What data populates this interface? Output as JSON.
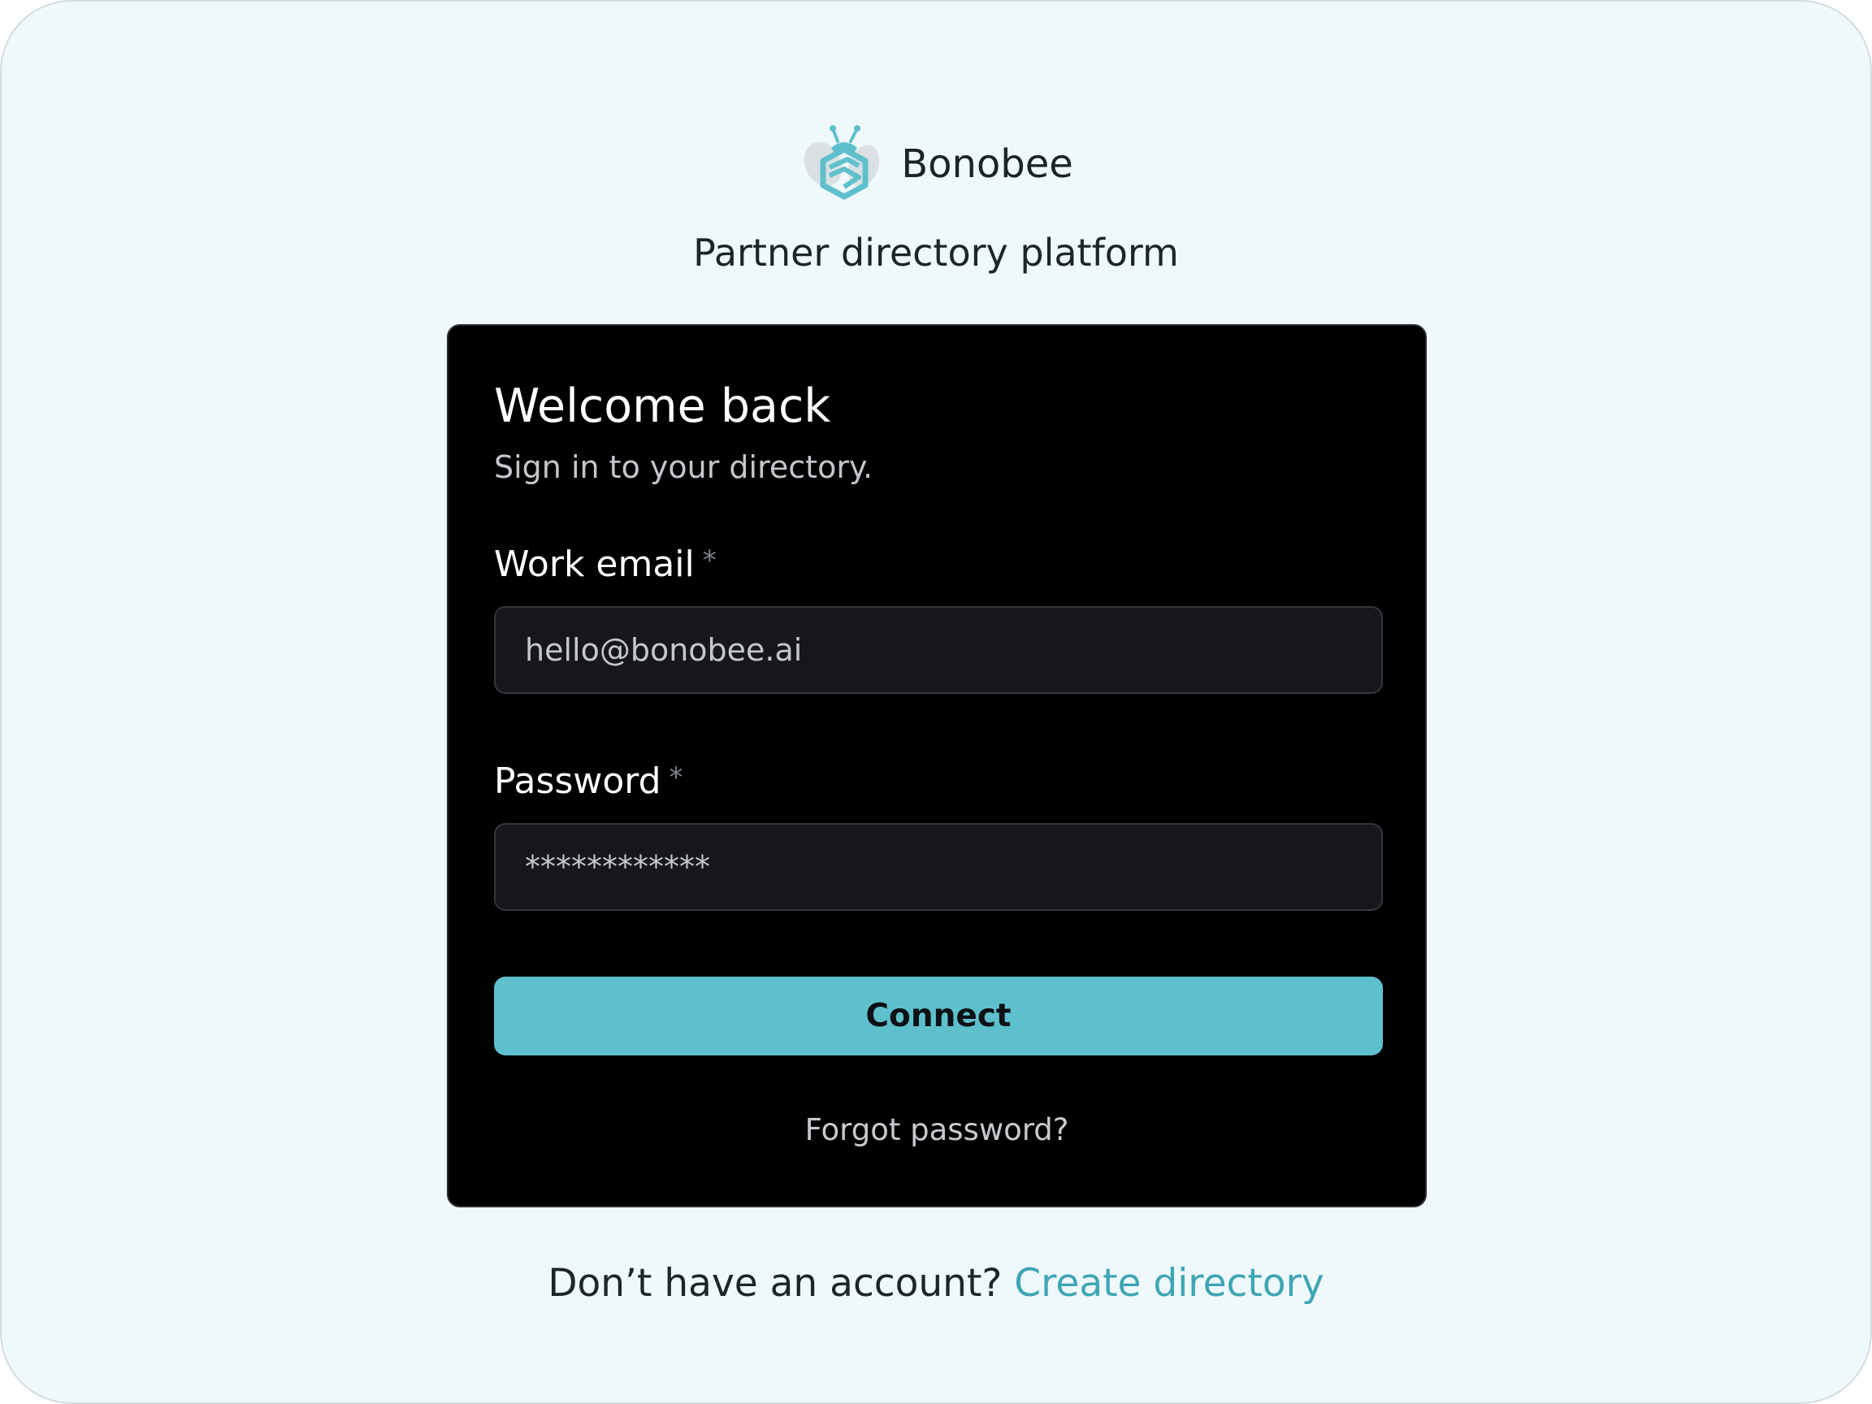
{
  "brand": {
    "name": "Bonobee",
    "logo_icon": "bee-logo-icon",
    "tagline": "Partner directory platform"
  },
  "login_card": {
    "title": "Welcome back",
    "subtitle": "Sign in to your directory.",
    "email_label": "Work email",
    "email_required_marker": "*",
    "email_value": "hello@bonobee.ai",
    "password_label": "Password",
    "password_required_marker": "*",
    "password_value": "************",
    "connect_button": "Connect",
    "forgot_link": "Forgot password?"
  },
  "footer": {
    "prompt": "Don’t have an account?",
    "create_link": "Create directory"
  },
  "colors": {
    "page_background": "#eff8fb",
    "card_background": "#000000",
    "input_background": "#16171b",
    "accent": "#5fc0cd",
    "link": "#3ea6b4",
    "text_dark": "#1e2529"
  }
}
